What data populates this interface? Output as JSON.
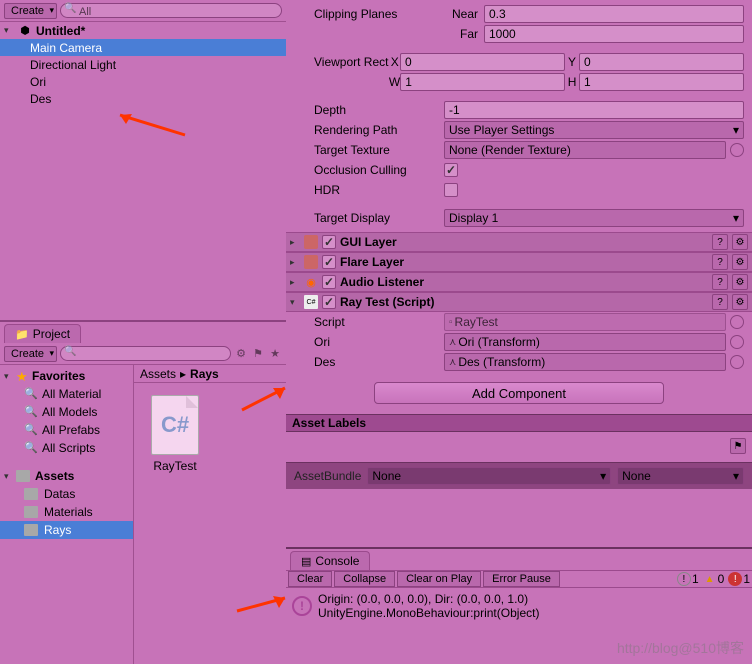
{
  "hierarchy": {
    "create_label": "Create",
    "search_placeholder": "All",
    "scene": "Untitled*",
    "items": [
      "Main Camera",
      "Directional Light",
      "Ori",
      "Des"
    ],
    "selected_index": 0
  },
  "project": {
    "tab_label": "Project",
    "create_label": "Create",
    "breadcrumb_root": "Assets",
    "breadcrumb_current": "Rays",
    "favorites_label": "Favorites",
    "favorites": [
      "All Material",
      "All Models",
      "All Prefabs",
      "All Scripts"
    ],
    "assets_label": "Assets",
    "folders": [
      "Datas",
      "Materials",
      "Rays"
    ],
    "selected_folder_index": 2,
    "grid_items": [
      {
        "name": "RayTest",
        "type": "C#"
      }
    ]
  },
  "inspector": {
    "clipping_planes_label": "Clipping Planes",
    "near_label": "Near",
    "near_value": "0.3",
    "far_label": "Far",
    "far_value": "1000",
    "viewport_rect_label": "Viewport Rect",
    "vr_x_label": "X",
    "vr_x": "0",
    "vr_y_label": "Y",
    "vr_y": "0",
    "vr_w_label": "W",
    "vr_w": "1",
    "vr_h_label": "H",
    "vr_h": "1",
    "depth_label": "Depth",
    "depth_value": "-1",
    "rendering_path_label": "Rendering Path",
    "rendering_path_value": "Use Player Settings",
    "target_texture_label": "Target Texture",
    "target_texture_value": "None (Render Texture)",
    "occlusion_culling_label": "Occlusion Culling",
    "occlusion_culling_checked": true,
    "hdr_label": "HDR",
    "hdr_checked": false,
    "target_display_label": "Target Display",
    "target_display_value": "Display 1",
    "components": {
      "gui_layer": "GUI Layer",
      "flare_layer": "Flare Layer",
      "audio_listener": "Audio Listener",
      "ray_test": "Ray Test (Script)"
    },
    "raytest": {
      "script_label": "Script",
      "script_value": "RayTest",
      "ori_label": "Ori",
      "ori_value": "Ori (Transform)",
      "des_label": "Des",
      "des_value": "Des (Transform)"
    },
    "add_component_label": "Add Component",
    "asset_labels_header": "Asset Labels",
    "asset_bundle_label": "AssetBundle",
    "asset_bundle_value": "None",
    "asset_bundle_variant": "None"
  },
  "console": {
    "tab_label": "Console",
    "clear_label": "Clear",
    "collapse_label": "Collapse",
    "clear_on_play_label": "Clear on Play",
    "error_pause_label": "Error Pause",
    "info_count": "1",
    "warn_count": "0",
    "err_count": "1",
    "message_line1": "Origin: (0.0, 0.0, 0.0), Dir: (0.0, 0.0, 1.0)",
    "message_line2": "UnityEngine.MonoBehaviour:print(Object)"
  },
  "watermark": "http://blog@510博客"
}
